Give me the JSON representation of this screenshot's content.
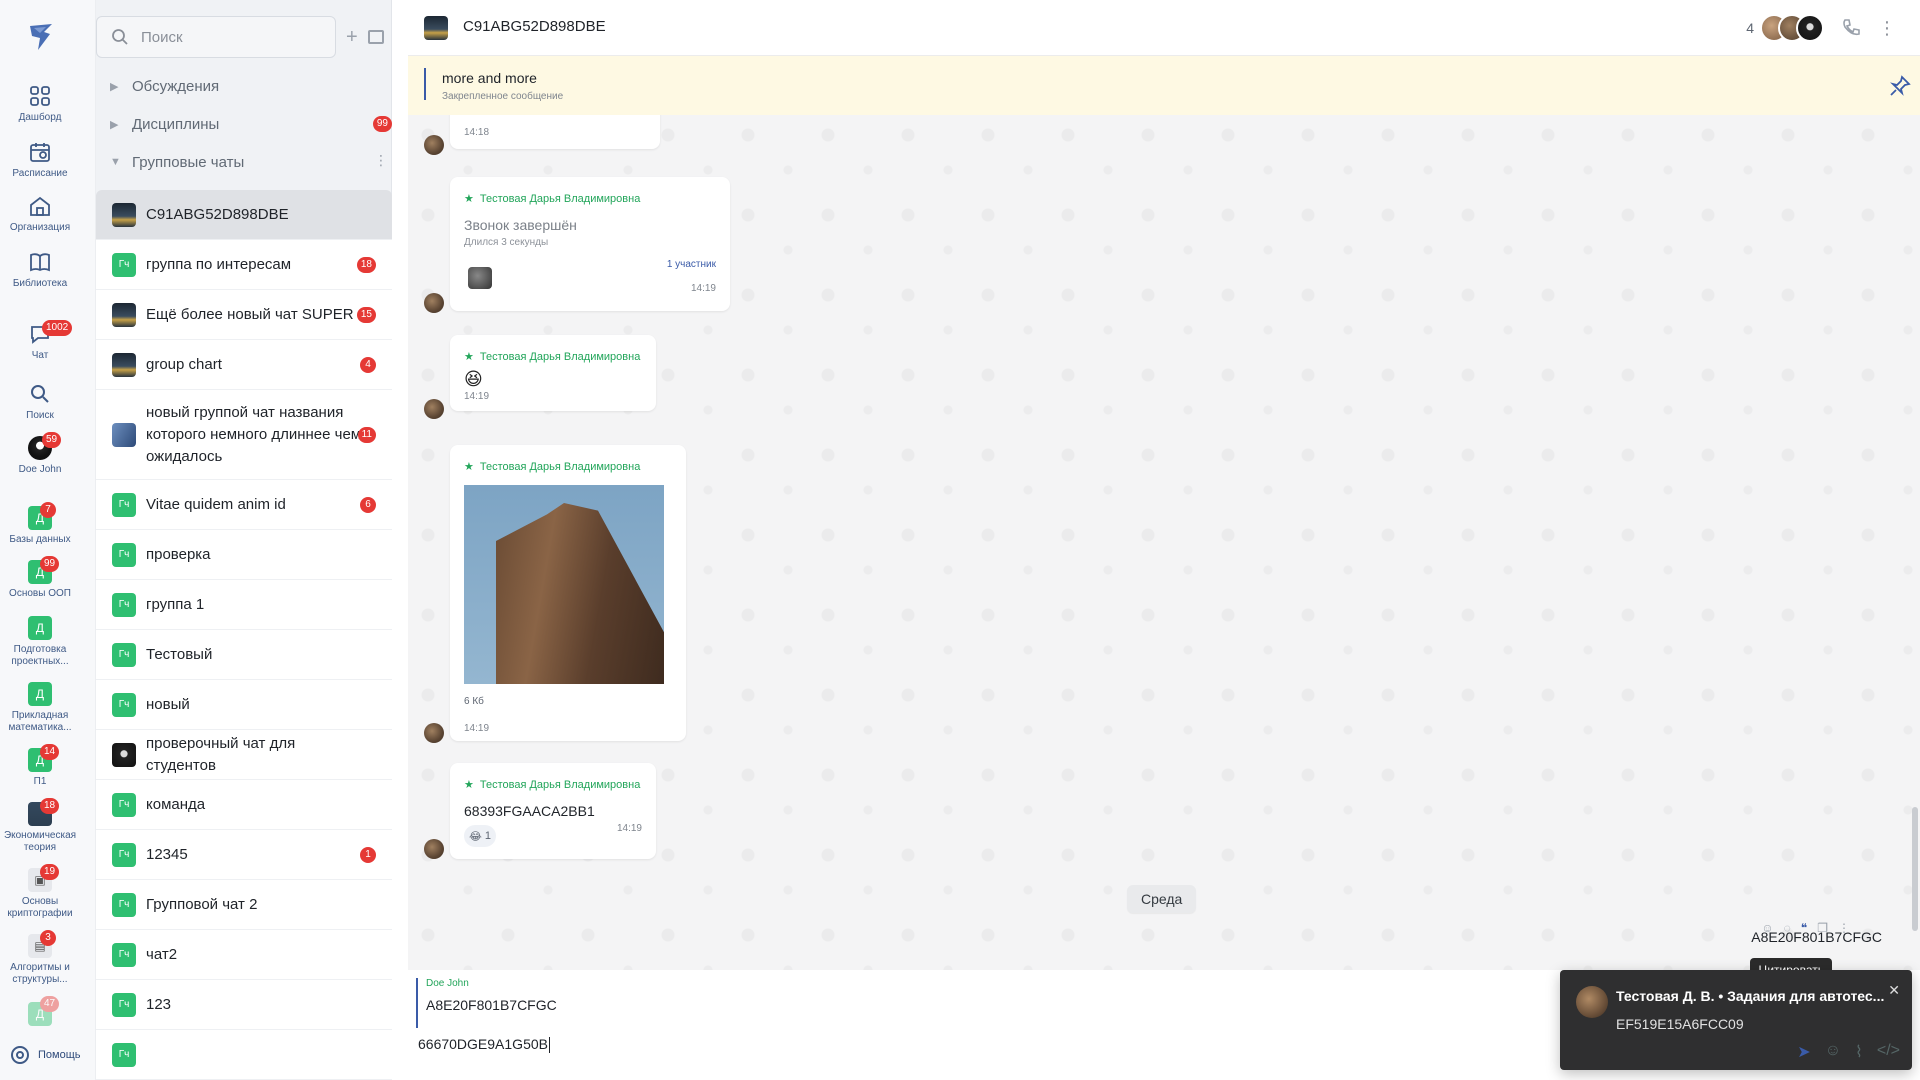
{
  "rail": {
    "items": [
      {
        "label": "Дашборд",
        "icon": "dashboard-icon"
      },
      {
        "label": "Расписание",
        "icon": "calendar-icon"
      },
      {
        "label": "Организация",
        "icon": "building-icon"
      },
      {
        "label": "Библиотека",
        "icon": "book-icon"
      },
      {
        "label": "Чат",
        "icon": "chat-icon",
        "badge": "1002"
      },
      {
        "label": "Поиск",
        "icon": "search-icon"
      },
      {
        "label": "Doe John",
        "icon": "avatar",
        "badge": "59"
      }
    ],
    "courses": [
      {
        "letter": "Д",
        "label": "Базы данных",
        "badge": "7"
      },
      {
        "letter": "Д",
        "label": "Основы ООП",
        "badge": "99"
      },
      {
        "letter": "Д",
        "label": "Подготовка проектных...",
        "badge": ""
      },
      {
        "letter": "Д",
        "label": "Прикладная математика...",
        "badge": ""
      },
      {
        "letter": "Д",
        "label": "П1",
        "badge": "14"
      },
      {
        "letter": "",
        "label": "Экономическая теория",
        "badge": "18"
      },
      {
        "letter": "",
        "label": "Основы криптографии",
        "badge": "19"
      },
      {
        "letter": "",
        "label": "Алгоритмы и структуры...",
        "badge": "3"
      },
      {
        "letter": "Д",
        "label": "",
        "badge": "47"
      }
    ],
    "help": "Помощь"
  },
  "list": {
    "search_placeholder": "Поиск",
    "sections": [
      {
        "label": "Обсуждения",
        "badge": ""
      },
      {
        "label": "Дисциплины",
        "badge": "99"
      },
      {
        "label": "Групповые чаты",
        "badge": ""
      }
    ],
    "chats": [
      {
        "name": "C91ABG52D898DBE",
        "badge": "",
        "av": "photo-dark",
        "active": true
      },
      {
        "name": "группа по интересам",
        "badge": "18",
        "av": "gc"
      },
      {
        "name": "Ещё более новый чат SUPER",
        "badge": "15",
        "av": "photo-dark"
      },
      {
        "name": "group chart",
        "badge": "4",
        "av": "photo-dark"
      },
      {
        "name": "новый группой чат названия которого немного длиннее чем ожидалось",
        "badge": "11",
        "av": "photo-blue"
      },
      {
        "name": "Vitae quidem anim id",
        "badge": "6",
        "av": "gc"
      },
      {
        "name": "проверка",
        "badge": "",
        "av": "gc"
      },
      {
        "name": "группа 1",
        "badge": "",
        "av": "gc"
      },
      {
        "name": "Тестовый",
        "badge": "",
        "av": "gc"
      },
      {
        "name": "новый",
        "badge": "",
        "av": "gc"
      },
      {
        "name": "проверочный чат для студентов",
        "badge": "",
        "av": "photo-alien"
      },
      {
        "name": "команда",
        "badge": "",
        "av": "gc"
      },
      {
        "name": "12345",
        "badge": "1",
        "av": "gc"
      },
      {
        "name": "Групповой чат 2",
        "badge": "",
        "av": "gc"
      },
      {
        "name": "чат2",
        "badge": "",
        "av": "gc"
      },
      {
        "name": "123",
        "badge": "",
        "av": "gc"
      },
      {
        "name": "",
        "badge": "",
        "av": "gc"
      }
    ],
    "gc_letters": "Гч"
  },
  "header": {
    "title": "C91ABG52D898DBE",
    "member_count": "4"
  },
  "pinned": {
    "text": "more and more",
    "sub": "Закрепленное сообщение"
  },
  "messages": {
    "m0": {
      "time": "14:18"
    },
    "m1": {
      "sender": "Тестовая Дарья Владимировна",
      "call_title": "Звонок завершён",
      "call_sub": "Длился 3 секунды",
      "participants": "1 участник",
      "time": "14:19"
    },
    "m2": {
      "sender": "Тестовая Дарья Владимировна",
      "emoji": "😆",
      "time": "14:19"
    },
    "m3": {
      "sender": "Тестовая Дарья Владимировна",
      "size": "6 Кб",
      "time": "14:19"
    },
    "m4": {
      "sender": "Тестовая Дарья Владимировна",
      "text": "68393FGAACA2BB1",
      "reaction": "😂",
      "reaction_count": "1",
      "time": "14:19"
    }
  },
  "date_chip": "Среда",
  "partial_outgoing": "A8E20F801B7CFGC",
  "tooltip": "Цитировать",
  "composer": {
    "reply_name": "Doe John",
    "reply_text": "A8E20F801B7CFGC",
    "input_value": "66670DGE9A1G50B"
  },
  "toast": {
    "title": "Тестовая Д. В. • Задания для автотес...",
    "body": "EF519E15A6FCC09"
  },
  "colors": {
    "accent": "#3a5ba8",
    "green": "#2fbf71",
    "badge": "#e53935",
    "pinned_bg": "#fef9e3"
  }
}
